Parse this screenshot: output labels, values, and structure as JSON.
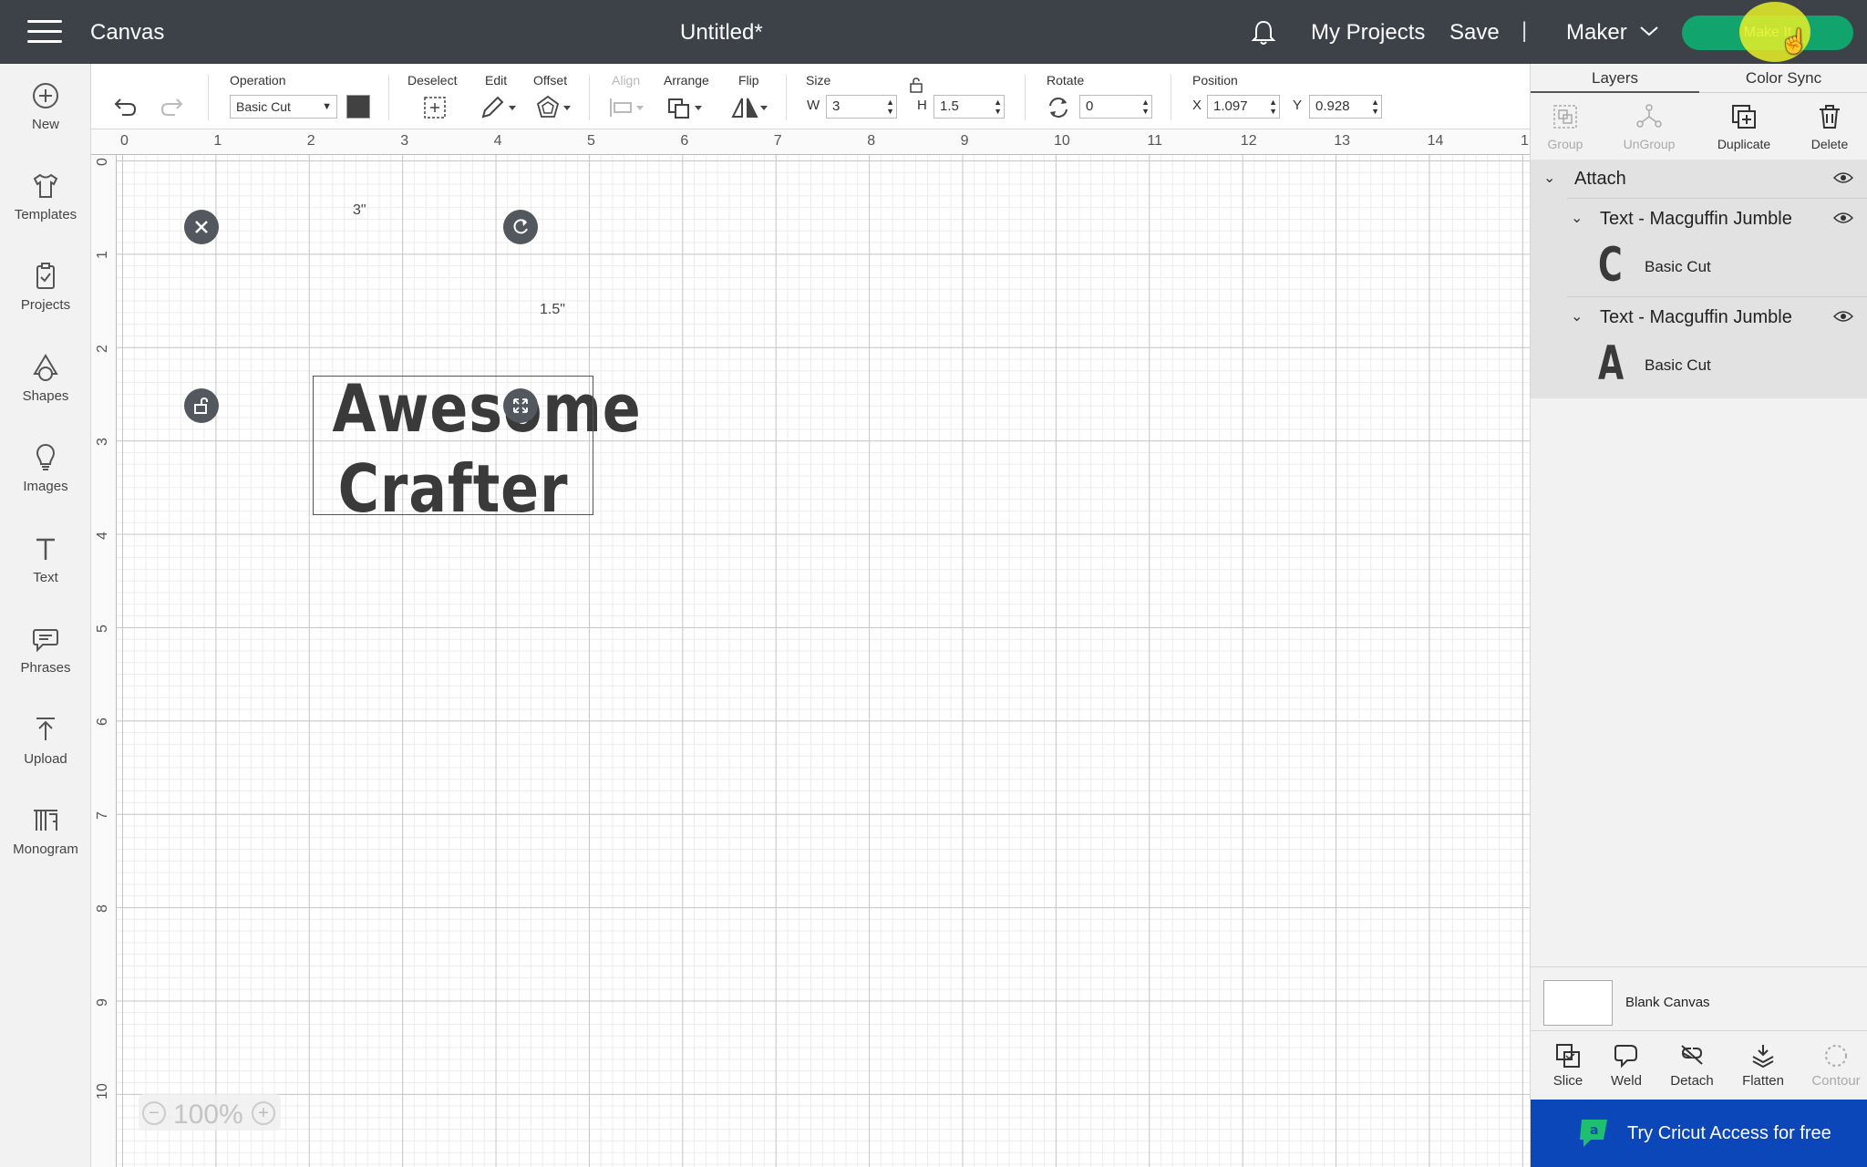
{
  "header": {
    "app_title": "Canvas",
    "doc_title": "Untitled*",
    "my_projects": "My Projects",
    "save": "Save",
    "separator": "|",
    "machine": "Maker",
    "make_it": "Make It",
    "accent_color": "#11a46c"
  },
  "sidebar": {
    "items": [
      {
        "label": "New",
        "icon": "plus-circle-icon"
      },
      {
        "label": "Templates",
        "icon": "tshirt-icon"
      },
      {
        "label": "Projects",
        "icon": "clipboard-icon"
      },
      {
        "label": "Shapes",
        "icon": "shapes-icon"
      },
      {
        "label": "Images",
        "icon": "lightbulb-icon"
      },
      {
        "label": "Text",
        "icon": "text-icon"
      },
      {
        "label": "Phrases",
        "icon": "speech-bubble-icon"
      },
      {
        "label": "Upload",
        "icon": "upload-icon"
      },
      {
        "label": "Monogram",
        "icon": "monogram-icon"
      }
    ]
  },
  "toolbar": {
    "operation_label": "Operation",
    "operation_value": "Basic Cut",
    "operation_color": "#414141",
    "deselect_label": "Deselect",
    "edit_label": "Edit",
    "offset_label": "Offset",
    "align_label": "Align",
    "arrange_label": "Arrange",
    "flip_label": "Flip",
    "size_label": "Size",
    "w_label": "W",
    "w_value": "3",
    "h_label": "H",
    "h_value": "1.5",
    "rotate_label": "Rotate",
    "rotate_value": "0",
    "position_label": "Position",
    "x_label": "X",
    "x_value": "1.097",
    "y_label": "Y",
    "y_value": "0.928"
  },
  "canvas": {
    "ruler_top": [
      "0",
      "1",
      "2",
      "3",
      "4",
      "5",
      "6",
      "7",
      "8",
      "9",
      "10",
      "11",
      "12",
      "13",
      "14",
      "1"
    ],
    "ruler_left": [
      "0",
      "1",
      "2",
      "3",
      "4",
      "5",
      "6",
      "7",
      "8",
      "9",
      "10"
    ],
    "artwork_line1": "Awesome",
    "artwork_line2": "Crafter",
    "width_dim": "3\"",
    "height_dim": "1.5\"",
    "zoom": "100%"
  },
  "panel": {
    "tab_layers": "Layers",
    "tab_color_sync": "Color Sync",
    "tools": [
      {
        "label": "Group",
        "icon": "group-icon",
        "enabled": false
      },
      {
        "label": "UnGroup",
        "icon": "ungroup-icon",
        "enabled": false
      },
      {
        "label": "Duplicate",
        "icon": "duplicate-icon",
        "enabled": true
      },
      {
        "label": "Delete",
        "icon": "trash-icon",
        "enabled": true
      }
    ],
    "attach_label": "Attach",
    "layers": [
      {
        "title": "Text - Macguffin Jumble",
        "glyph": "C",
        "operation": "Basic Cut"
      },
      {
        "title": "Text - Macguffin Jumble",
        "glyph": "A",
        "operation": "Basic Cut"
      }
    ],
    "blank_canvas": "Blank Canvas",
    "bottom_tools": [
      {
        "label": "Slice",
        "icon": "slice-icon",
        "enabled": true
      },
      {
        "label": "Weld",
        "icon": "weld-icon",
        "enabled": true
      },
      {
        "label": "Detach",
        "icon": "detach-icon",
        "enabled": true
      },
      {
        "label": "Flatten",
        "icon": "flatten-icon",
        "enabled": true
      },
      {
        "label": "Contour",
        "icon": "contour-icon",
        "enabled": false
      }
    ],
    "access_banner": "Try Cricut Access for free",
    "access_color": "#0b47b8"
  }
}
